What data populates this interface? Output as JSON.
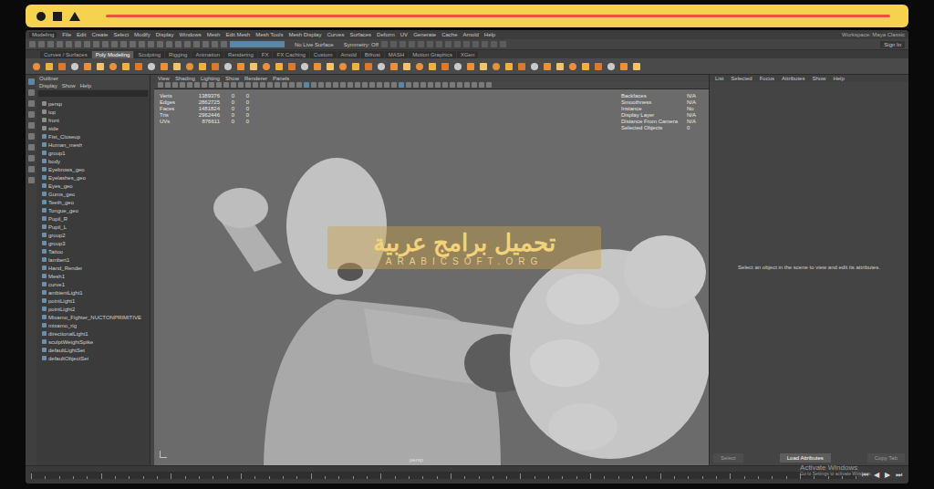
{
  "menu": [
    "File",
    "Edit",
    "Create",
    "Select",
    "Modify",
    "Display",
    "Windows",
    "Mesh",
    "Edit Mesh",
    "Mesh Tools",
    "Mesh Display",
    "Curves",
    "Surfaces",
    "Deform",
    "UV",
    "Generate",
    "Cache",
    "Arnold",
    "Help"
  ],
  "workspace": "Workspace: Maya Classic",
  "mode": "Modeling",
  "status": {
    "symmetry": "Symmetry: Off",
    "live": "No Live Surface",
    "sign_in": "Sign In"
  },
  "shelf_tabs": [
    {
      "label": "Curves / Surfaces",
      "selected": false
    },
    {
      "label": "Poly Modeling",
      "selected": true
    },
    {
      "label": "Sculpting",
      "selected": false
    },
    {
      "label": "Rigging",
      "selected": false
    },
    {
      "label": "Animation",
      "selected": false
    },
    {
      "label": "Rendering",
      "selected": false
    },
    {
      "label": "FX",
      "selected": false
    },
    {
      "label": "FX Caching",
      "selected": false
    },
    {
      "label": "Custom",
      "selected": false
    },
    {
      "label": "Arnold",
      "selected": false
    },
    {
      "label": "Bifrost",
      "selected": false
    },
    {
      "label": "MASH",
      "selected": false
    },
    {
      "label": "Motion Graphics",
      "selected": false
    },
    {
      "label": "XGen",
      "selected": false
    }
  ],
  "outliner": {
    "title": "Outliner",
    "menu": [
      "Display",
      "Show",
      "Help"
    ],
    "items": [
      "persp",
      "top",
      "front",
      "side",
      "Fist_Closeup",
      "Human_mesh",
      "group1",
      "body",
      "Eyebrows_geo",
      "Eyelashes_geo",
      "Eyes_geo",
      "Gums_geo",
      "Teeth_geo",
      "Tongue_geo",
      "Pupil_R",
      "Pupil_L",
      "group2",
      "group3",
      "Tattoo",
      "lambert1",
      "Hand_Render",
      "Mesh1",
      "curve1",
      "ambientLight1",
      "pointLight1",
      "pointLight2",
      "Mixamo_Fighter_NUCTONPRIMITIVE",
      "mixamo_rig",
      "directionalLight1",
      "sculptWeightSpike",
      "defaultLightSet",
      "defaultObjectSet"
    ]
  },
  "viewport": {
    "menu": [
      "View",
      "Shading",
      "Lighting",
      "Show",
      "Renderer",
      "Panels"
    ],
    "hud_left": [
      [
        "Verts",
        "1389376",
        "0",
        "0"
      ],
      [
        "Edges",
        "2862725",
        "0",
        "0"
      ],
      [
        "Faces",
        "1481824",
        "0",
        "0"
      ],
      [
        "Tris",
        "2962446",
        "0",
        "0"
      ],
      [
        "UVs",
        "876611",
        "0",
        "0"
      ]
    ],
    "hud_right": [
      [
        "Backfaces",
        "N/A"
      ],
      [
        "Smoothness",
        "N/A"
      ],
      [
        "Instance",
        "No"
      ],
      [
        "Display Layer",
        "N/A"
      ],
      [
        "Distance From Camera",
        "N/A"
      ],
      [
        "Selected Objects",
        "0"
      ]
    ],
    "camera": "persp"
  },
  "attribute_editor": {
    "tabs": [
      "List",
      "Selected",
      "Focus",
      "Attributes",
      "Show",
      "Help"
    ],
    "message": "Select an object in the scene to view and edit its attributes.",
    "buttons": [
      "Select",
      "Load Attributes",
      "Copy Tab"
    ]
  },
  "watermark": {
    "arabic": "تحميل برامج عربية",
    "latin": "ARABICSOFT.ORG"
  },
  "activation": {
    "title": "Activate Windows",
    "subtitle": "Go to Settings to activate Windows."
  },
  "timeline": {
    "controls": [
      "⏮",
      "◀",
      "▶",
      "⏭"
    ]
  }
}
